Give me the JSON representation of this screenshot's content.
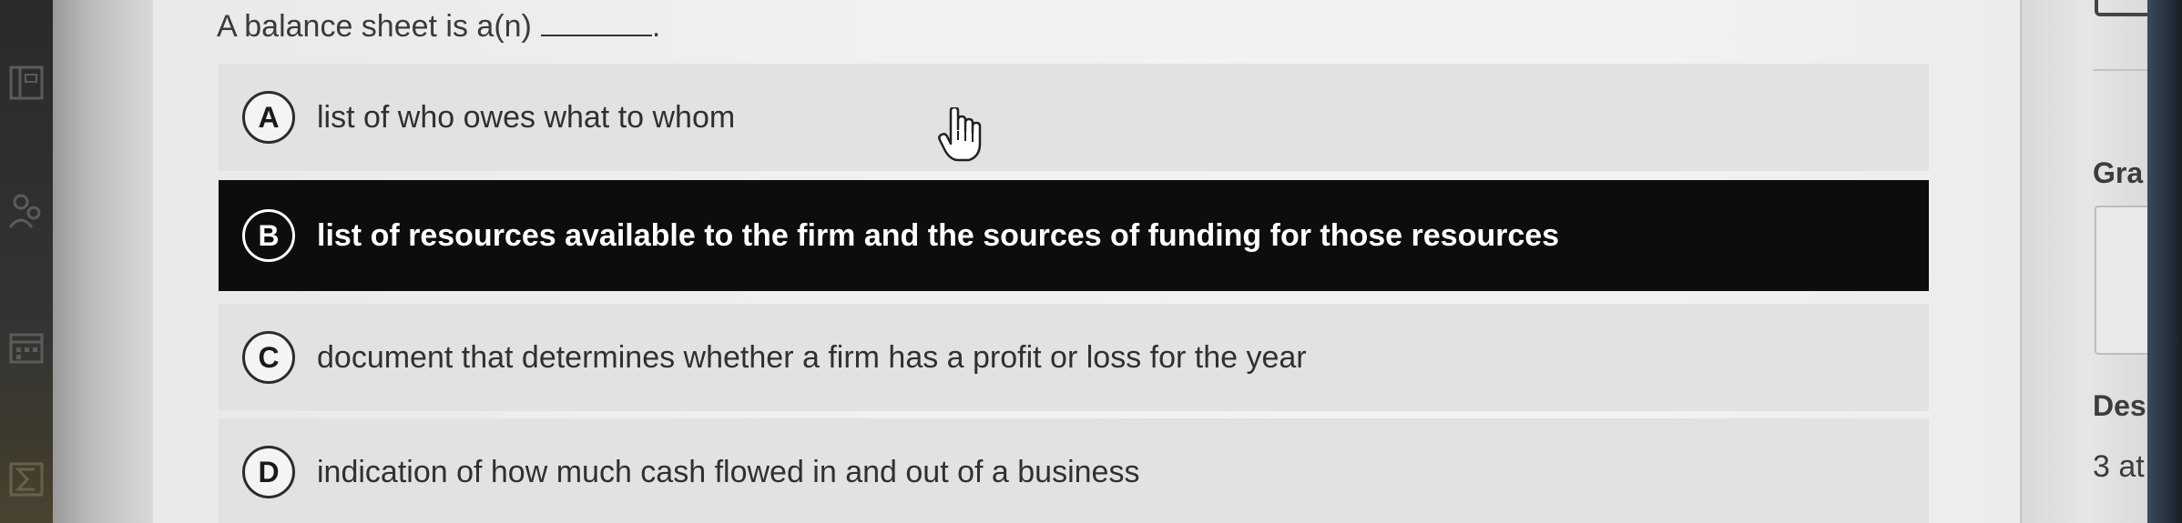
{
  "question": {
    "text": "A balance sheet is a(n)",
    "end_punct": "."
  },
  "options": [
    {
      "letter": "A",
      "text": "list of who owes what to whom",
      "selected": false
    },
    {
      "letter": "B",
      "text": "list of resources available to the firm and the sources of funding for those resources",
      "selected": true
    },
    {
      "letter": "C",
      "text": "document that determines whether a firm has a profit or loss for the year",
      "selected": false
    },
    {
      "letter": "D",
      "text": "indication of how much cash flowed in and out of a business",
      "selected": false
    }
  ],
  "right_panel": {
    "label_1": "Gra",
    "label_2": "Des",
    "value_1": "3 at"
  },
  "colors": {
    "selected_bg": "#0d0d0d",
    "option_bg": "#e2e2e2",
    "text": "#303030"
  },
  "icons": {
    "cursor": "hand-pointer-icon",
    "rail_1": "book-icon",
    "rail_2": "users-icon",
    "rail_3": "calendar-icon",
    "rail_4": "sigma-icon"
  }
}
